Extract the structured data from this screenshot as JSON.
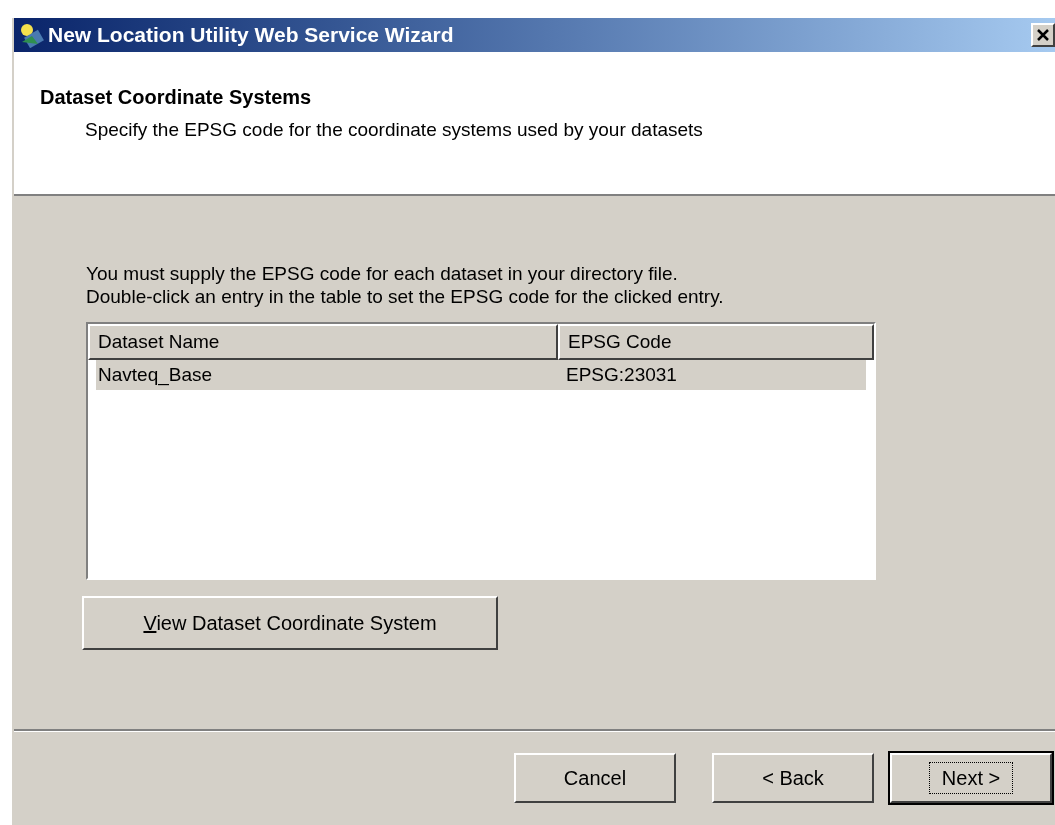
{
  "window": {
    "title": "New Location Utility Web Service Wizard"
  },
  "header": {
    "title": "Dataset Coordinate Systems",
    "subtitle": "Specify the EPSG code for the coordinate systems used by your datasets"
  },
  "instructions": [
    "You must supply the EPSG code for each dataset in your directory file.",
    "Double-click an entry in the table to set the EPSG code for the clicked entry."
  ],
  "table": {
    "columns": [
      "Dataset Name",
      "EPSG Code"
    ],
    "rows": [
      {
        "cells": [
          "Navteq_Base",
          "EPSG:23031"
        ],
        "selected": true
      }
    ]
  },
  "view_button": {
    "mnemonic_letter": "V",
    "label_rest": "iew Dataset Coordinate System"
  },
  "buttons": [
    {
      "label": "Cancel",
      "default": false
    },
    {
      "label": "< Back",
      "default": false
    },
    {
      "label": "Next >",
      "default": true
    }
  ]
}
